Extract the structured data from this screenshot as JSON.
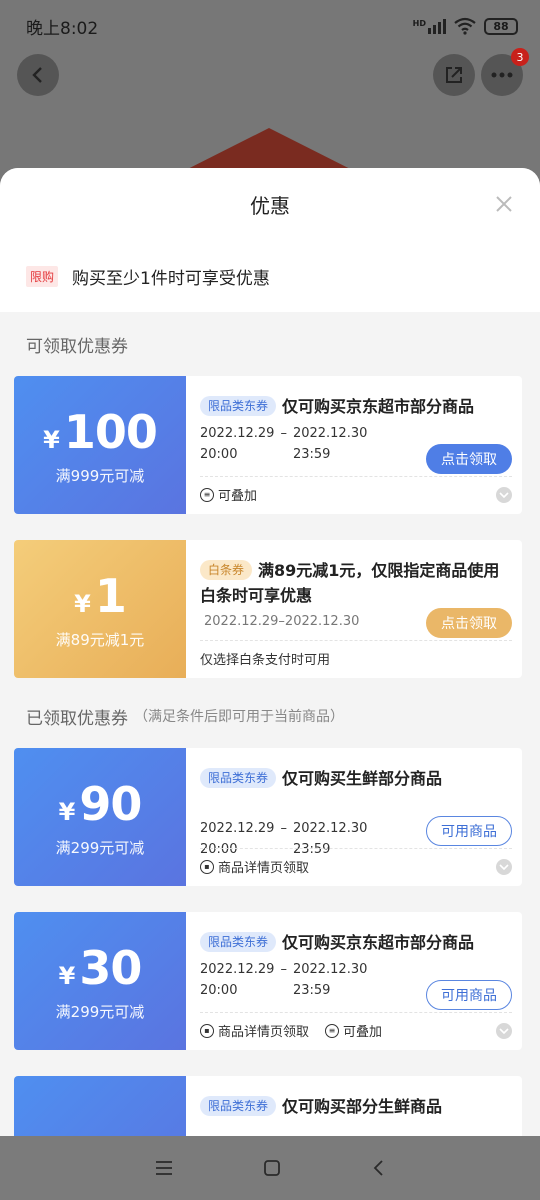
{
  "status": {
    "time": "晚上8:02",
    "battery": "88",
    "signal_label": "HD"
  },
  "topbar": {
    "badge_count": "3"
  },
  "sheet": {
    "title": "优惠",
    "limit": {
      "tag": "限购",
      "text": "购买至少1件时可享受优惠"
    },
    "available_title": "可领取优惠券",
    "claimed_title": "已领取优惠券",
    "claimed_subtitle": "（满足条件后即可用于当前商品）"
  },
  "available": [
    {
      "yen": "¥",
      "amount": "100",
      "cond": "满999元可减",
      "tag": "限品类东券",
      "title": "仅可购买京东超市部分商品",
      "start_date": "2022.12.29",
      "start_time": "20:00",
      "end_date": "2022.12.30",
      "end_time": "23:59",
      "action": "点击领取",
      "note": "可叠加"
    },
    {
      "yen": "¥",
      "amount": "1",
      "cond": "满89元减1元",
      "tag": "白条券",
      "title": "满89元减1元，仅限指定商品使用白条时可享优惠",
      "date_range": "2022.12.29–2022.12.30",
      "action": "点击领取",
      "note": "仅选择白条支付时可用"
    }
  ],
  "claimed": [
    {
      "yen": "¥",
      "amount": "90",
      "cond": "满299元可减",
      "tag": "限品类东券",
      "title": "仅可购买生鲜部分商品",
      "start_date": "2022.12.29",
      "start_time": "20:00",
      "end_date": "2022.12.30",
      "end_time": "23:59",
      "action": "可用商品",
      "note1": "商品详情页领取"
    },
    {
      "yen": "¥",
      "amount": "30",
      "cond": "满299元可减",
      "tag": "限品类东券",
      "title": "仅可购买京东超市部分商品",
      "start_date": "2022.12.29",
      "start_time": "20:00",
      "end_date": "2022.12.30",
      "end_time": "23:59",
      "action": "可用商品",
      "note1": "商品详情页领取",
      "note2": "可叠加"
    },
    {
      "tag": "限品类东券",
      "title": "仅可购买部分生鲜商品"
    }
  ],
  "colors": {
    "accent_blue": "#4f7ee6",
    "accent_gold": "#eab768",
    "limit_red": "#e4393c"
  }
}
